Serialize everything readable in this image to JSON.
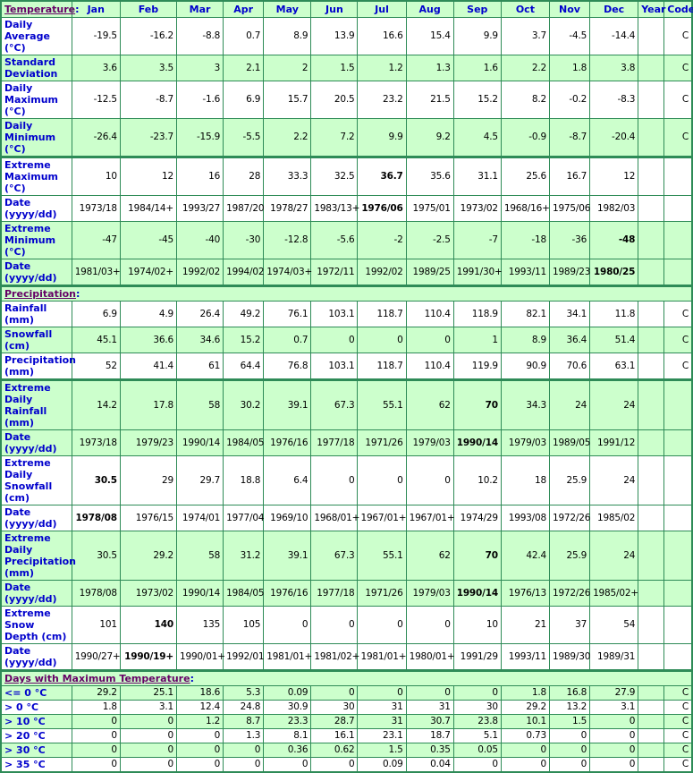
{
  "columns": [
    "Jan",
    "Feb",
    "Mar",
    "Apr",
    "May",
    "Jun",
    "Jul",
    "Aug",
    "Sep",
    "Oct",
    "Nov",
    "Dec",
    "Year",
    "Code"
  ],
  "colors": {
    "border": "#2e8b57",
    "header_bg": "#ccffcc",
    "label_text": "#0000cc",
    "section_link": "#660066"
  },
  "sections": [
    {
      "title": "Temperature",
      "rows": [
        {
          "label": "Daily Average (°C)",
          "bg": "w",
          "h": 2,
          "values": [
            "-19.5",
            "-16.2",
            "-8.8",
            "0.7",
            "8.9",
            "13.9",
            "16.6",
            "15.4",
            "9.9",
            "3.7",
            "-4.5",
            "-14.4"
          ],
          "year": "",
          "code": "C"
        },
        {
          "label": "Standard Deviation",
          "bg": "g",
          "h": 2,
          "values": [
            "3.6",
            "3.5",
            "3",
            "2.1",
            "2",
            "1.5",
            "1.2",
            "1.3",
            "1.6",
            "2.2",
            "1.8",
            "3.8"
          ],
          "year": "",
          "code": "C"
        },
        {
          "label": "Daily Maximum (°C)",
          "bg": "w",
          "h": 3,
          "values": [
            "-12.5",
            "-8.7",
            "-1.6",
            "6.9",
            "15.7",
            "20.5",
            "23.2",
            "21.5",
            "15.2",
            "8.2",
            "-0.2",
            "-8.3"
          ],
          "year": "",
          "code": "C"
        },
        {
          "label": "Daily Minimum (°C)",
          "bg": "g",
          "h": 3,
          "values": [
            "-26.4",
            "-23.7",
            "-15.9",
            "-5.5",
            "2.2",
            "7.2",
            "9.9",
            "9.2",
            "4.5",
            "-0.9",
            "-8.7",
            "-20.4"
          ],
          "year": "",
          "code": "C"
        },
        {
          "label": "Extreme Maximum (°C)",
          "bg": "w",
          "h": 3,
          "thick": true,
          "values": [
            "10",
            "12",
            "16",
            "28",
            "33.3",
            "32.5",
            "36.7",
            "35.6",
            "31.1",
            "25.6",
            "16.7",
            "12"
          ],
          "bold": [
            6
          ],
          "year": "",
          "code": ""
        },
        {
          "label": "Date (yyyy/dd)",
          "bg": "w",
          "h": 2,
          "values": [
            "1973/18",
            "1984/14+",
            "1993/27",
            "1987/20",
            "1978/27",
            "1983/13+",
            "1976/06",
            "1975/01",
            "1973/02",
            "1968/16+",
            "1975/06",
            "1982/03"
          ],
          "bold": [
            6
          ],
          "year": "",
          "code": ""
        },
        {
          "label": "Extreme Minimum (°C)",
          "bg": "g",
          "h": 3,
          "values": [
            "-47",
            "-45",
            "-40",
            "-30",
            "-12.8",
            "-5.6",
            "-2",
            "-2.5",
            "-7",
            "-18",
            "-36",
            "-48"
          ],
          "bold": [
            11
          ],
          "year": "",
          "code": ""
        },
        {
          "label": "Date (yyyy/dd)",
          "bg": "g",
          "h": 2,
          "values": [
            "1981/03+",
            "1974/02+",
            "1992/02",
            "1994/02",
            "1974/03+",
            "1972/11",
            "1992/02",
            "1989/25",
            "1991/30+",
            "1993/11",
            "1989/23",
            "1980/25"
          ],
          "bold": [
            11
          ],
          "year": "",
          "code": ""
        }
      ]
    },
    {
      "title": "Precipitation",
      "rows": [
        {
          "label": "Rainfall (mm)",
          "bg": "w",
          "h": 1,
          "values": [
            "6.9",
            "4.9",
            "26.4",
            "49.2",
            "76.1",
            "103.1",
            "118.7",
            "110.4",
            "118.9",
            "82.1",
            "34.1",
            "11.8"
          ],
          "year": "",
          "code": "C"
        },
        {
          "label": "Snowfall (cm)",
          "bg": "g",
          "h": 2,
          "values": [
            "45.1",
            "36.6",
            "34.6",
            "15.2",
            "0.7",
            "0",
            "0",
            "0",
            "1",
            "8.9",
            "36.4",
            "51.4"
          ],
          "year": "",
          "code": "C"
        },
        {
          "label": "Precipitation (mm)",
          "bg": "w",
          "h": 2,
          "values": [
            "52",
            "41.4",
            "61",
            "64.4",
            "76.8",
            "103.1",
            "118.7",
            "110.4",
            "119.9",
            "90.9",
            "70.6",
            "63.1"
          ],
          "year": "",
          "code": "C"
        },
        {
          "label": "Extreme Daily Rainfall (mm)",
          "bg": "g",
          "h": 2,
          "thick": true,
          "values": [
            "14.2",
            "17.8",
            "58",
            "30.2",
            "39.1",
            "67.3",
            "55.1",
            "62",
            "70",
            "34.3",
            "24",
            "24"
          ],
          "bold": [
            8
          ],
          "year": "",
          "code": ""
        },
        {
          "label": "Date (yyyy/dd)",
          "bg": "g",
          "h": 2,
          "values": [
            "1973/18",
            "1979/23",
            "1990/14",
            "1984/05",
            "1976/16",
            "1977/18",
            "1971/26",
            "1979/03",
            "1990/14",
            "1979/03",
            "1989/05",
            "1991/12"
          ],
          "bold": [
            8
          ],
          "year": "",
          "code": ""
        },
        {
          "label": "Extreme Daily Snowfall (cm)",
          "bg": "w",
          "h": 3,
          "values": [
            "30.5",
            "29",
            "29.7",
            "18.8",
            "6.4",
            "0",
            "0",
            "0",
            "10.2",
            "18",
            "25.9",
            "24"
          ],
          "bold": [
            0
          ],
          "year": "",
          "code": ""
        },
        {
          "label": "Date (yyyy/dd)",
          "bg": "w",
          "h": 2,
          "values": [
            "1978/08",
            "1976/15",
            "1974/01",
            "1977/04",
            "1969/10",
            "1968/01+",
            "1967/01+",
            "1967/01+",
            "1974/29",
            "1993/08",
            "1972/26",
            "1985/02"
          ],
          "bold": [
            0
          ],
          "year": "",
          "code": ""
        },
        {
          "label": "Extreme Daily Precipitation (mm)",
          "bg": "g",
          "h": 3,
          "values": [
            "30.5",
            "29.2",
            "58",
            "31.2",
            "39.1",
            "67.3",
            "55.1",
            "62",
            "70",
            "42.4",
            "25.9",
            "24"
          ],
          "bold": [
            8
          ],
          "year": "",
          "code": ""
        },
        {
          "label": "Date (yyyy/dd)",
          "bg": "g",
          "h": 2,
          "values": [
            "1978/08",
            "1973/02",
            "1990/14",
            "1984/05",
            "1976/16",
            "1977/18",
            "1971/26",
            "1979/03",
            "1990/14",
            "1976/13",
            "1972/26",
            "1985/02+"
          ],
          "bold": [
            8
          ],
          "year": "",
          "code": ""
        },
        {
          "label": "Extreme Snow Depth (cm)",
          "bg": "w",
          "h": 3,
          "values": [
            "101",
            "140",
            "135",
            "105",
            "0",
            "0",
            "0",
            "0",
            "10",
            "21",
            "37",
            "54"
          ],
          "bold": [
            1
          ],
          "year": "",
          "code": ""
        },
        {
          "label": "Date (yyyy/dd)",
          "bg": "w",
          "h": 2,
          "values": [
            "1990/27+",
            "1990/19+",
            "1990/01+",
            "1992/01",
            "1981/01+",
            "1981/02+",
            "1981/01+",
            "1980/01+",
            "1991/29",
            "1993/11",
            "1989/30",
            "1989/31"
          ],
          "bold": [
            1
          ],
          "year": "",
          "code": ""
        }
      ]
    },
    {
      "title": "Days with Maximum Temperature",
      "rows": [
        {
          "label": "<= 0 °C",
          "bg": "g",
          "h": 1,
          "values": [
            "29.2",
            "25.1",
            "18.6",
            "5.3",
            "0.09",
            "0",
            "0",
            "0",
            "0",
            "1.8",
            "16.8",
            "27.9"
          ],
          "year": "",
          "code": "C"
        },
        {
          "label": "> 0 °C",
          "bg": "w",
          "h": 1,
          "values": [
            "1.8",
            "3.1",
            "12.4",
            "24.8",
            "30.9",
            "30",
            "31",
            "31",
            "30",
            "29.2",
            "13.2",
            "3.1"
          ],
          "year": "",
          "code": "C"
        },
        {
          "label": "> 10 °C",
          "bg": "g",
          "h": 1,
          "values": [
            "0",
            "0",
            "1.2",
            "8.7",
            "23.3",
            "28.7",
            "31",
            "30.7",
            "23.8",
            "10.1",
            "1.5",
            "0"
          ],
          "year": "",
          "code": "C"
        },
        {
          "label": "> 20 °C",
          "bg": "w",
          "h": 1,
          "values": [
            "0",
            "0",
            "0",
            "1.3",
            "8.1",
            "16.1",
            "23.1",
            "18.7",
            "5.1",
            "0.73",
            "0",
            "0"
          ],
          "year": "",
          "code": "C"
        },
        {
          "label": "> 30 °C",
          "bg": "g",
          "h": 1,
          "values": [
            "0",
            "0",
            "0",
            "0",
            "0.36",
            "0.62",
            "1.5",
            "0.35",
            "0.05",
            "0",
            "0",
            "0"
          ],
          "year": "",
          "code": "C"
        },
        {
          "label": "> 35 °C",
          "bg": "w",
          "h": 1,
          "values": [
            "0",
            "0",
            "0",
            "0",
            "0",
            "0",
            "0.09",
            "0.04",
            "0",
            "0",
            "0",
            "0"
          ],
          "year": "",
          "code": "C"
        }
      ]
    }
  ]
}
